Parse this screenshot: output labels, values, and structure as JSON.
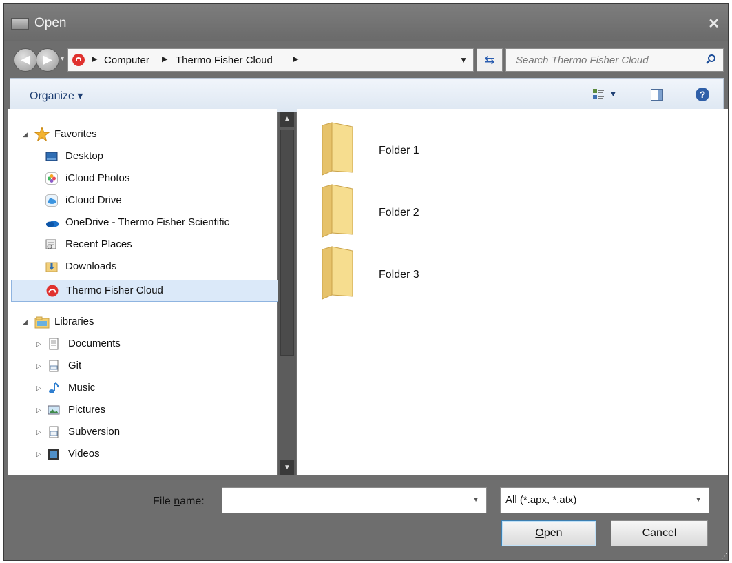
{
  "window": {
    "title": "Open",
    "close_glyph": "✕"
  },
  "address": {
    "breadcrumbs": [
      "Computer",
      "Thermo Fisher Cloud"
    ],
    "search_placeholder": "Search Thermo Fisher Cloud"
  },
  "toolbar": {
    "organize_label": "Organize ▾"
  },
  "nav": {
    "favorites_header": "Favorites",
    "favorites": [
      {
        "label": "Desktop",
        "icon": "desktop-icon"
      },
      {
        "label": "iCloud Photos",
        "icon": "icloud-photos-icon"
      },
      {
        "label": "iCloud Drive",
        "icon": "icloud-drive-icon"
      },
      {
        "label": "OneDrive - Thermo Fisher Scientific",
        "icon": "onedrive-icon"
      },
      {
        "label": "Recent Places",
        "icon": "recent-places-icon"
      },
      {
        "label": "Downloads",
        "icon": "downloads-icon"
      },
      {
        "label": "Thermo Fisher Cloud",
        "icon": "thermo-fisher-cloud-icon",
        "selected": true
      }
    ],
    "libraries_header": "Libraries",
    "libraries": [
      {
        "label": "Documents",
        "icon": "documents-icon"
      },
      {
        "label": "Git",
        "icon": "git-icon"
      },
      {
        "label": "Music",
        "icon": "music-icon"
      },
      {
        "label": "Pictures",
        "icon": "pictures-icon"
      },
      {
        "label": "Subversion",
        "icon": "subversion-icon"
      },
      {
        "label": "Videos",
        "icon": "videos-icon"
      }
    ]
  },
  "content": {
    "folders": [
      "Folder 1",
      "Folder 2",
      "Folder 3"
    ]
  },
  "footer": {
    "filename_label_pre": "File ",
    "filename_label_access": "n",
    "filename_label_post": "ame:",
    "filename_value": "",
    "filter_value": "All (*.apx, *.atx)",
    "open_access": "O",
    "open_rest": "pen",
    "cancel_label": "Cancel"
  },
  "colors": {
    "selection": "#dbe9f9",
    "chrome": "#6e6e6e",
    "link": "#1e3f73"
  }
}
